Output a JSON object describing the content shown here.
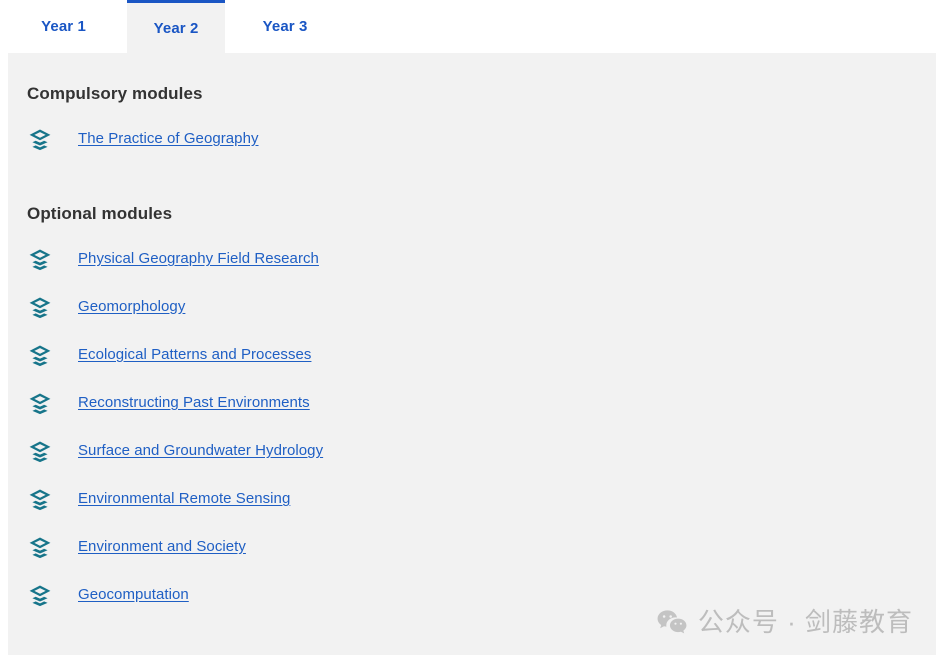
{
  "tabs": [
    {
      "label": "Year 1",
      "active": false
    },
    {
      "label": "Year 2",
      "active": true
    },
    {
      "label": "Year 3",
      "active": false
    }
  ],
  "sections": [
    {
      "heading": "Compulsory modules",
      "modules": [
        {
          "label": "The Practice of Geography",
          "icon": "layers-icon"
        }
      ]
    },
    {
      "heading": "Optional modules",
      "modules": [
        {
          "label": "Physical Geography Field Research",
          "icon": "layers-icon"
        },
        {
          "label": "Geomorphology",
          "icon": "layers-icon"
        },
        {
          "label": "Ecological Patterns and Processes",
          "icon": "layers-icon"
        },
        {
          "label": "Reconstructing Past Environments",
          "icon": "layers-icon"
        },
        {
          "label": "Surface and Groundwater Hydrology",
          "icon": "layers-icon"
        },
        {
          "label": "Environmental Remote Sensing",
          "icon": "layers-icon"
        },
        {
          "label": "Environment and Society",
          "icon": "layers-icon"
        },
        {
          "label": "Geocomputation",
          "icon": "layers-icon"
        }
      ]
    }
  ],
  "watermark": {
    "icon": "wechat-icon",
    "text": "公众号 · 剑藤教育"
  },
  "colors": {
    "tab_accent": "#1a56c4",
    "link": "#1f5fc4",
    "heading": "#333333",
    "icon_teal": "#17758a",
    "panel_background": "#f2f2f2",
    "page_background": "#ffffff",
    "watermark": "#bdbdbd"
  }
}
